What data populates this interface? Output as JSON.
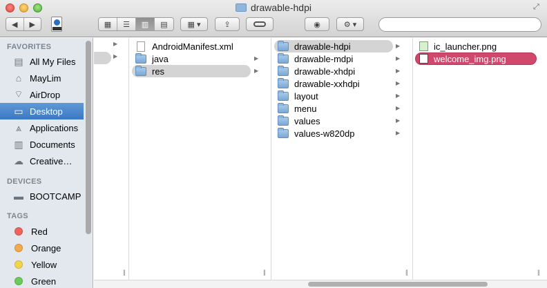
{
  "window": {
    "title": "drawable-hdpi"
  },
  "toolbar": {
    "back_icon": "chevron-left",
    "forward_icon": "chevron-right",
    "search_placeholder": "",
    "views": [
      "icon",
      "list",
      "column",
      "cover-flow"
    ],
    "active_view": "column"
  },
  "sidebar": {
    "favorites_header": "FAVORITES",
    "devices_header": "DEVICES",
    "tags_header": "TAGS",
    "favorites": [
      {
        "label": "All My Files",
        "icon": "all-files-icon"
      },
      {
        "label": "MayLim",
        "icon": "home-icon"
      },
      {
        "label": "AirDrop",
        "icon": "airdrop-icon"
      },
      {
        "label": "Desktop",
        "icon": "desktop-icon"
      },
      {
        "label": "Applications",
        "icon": "applications-icon"
      },
      {
        "label": "Documents",
        "icon": "documents-icon"
      },
      {
        "label": "Creative…",
        "icon": "creative-cloud-icon"
      }
    ],
    "devices": [
      {
        "label": "BOOTCAMP",
        "icon": "disk-icon"
      }
    ],
    "tags": [
      {
        "label": "Red",
        "color": "#f0625c"
      },
      {
        "label": "Orange",
        "color": "#f5a94a"
      },
      {
        "label": "Yellow",
        "color": "#f3d54b"
      },
      {
        "label": "Green",
        "color": "#6bcb5a"
      }
    ],
    "selected": "Desktop"
  },
  "columns": {
    "col2": [
      {
        "label": "AndroidManifest.xml",
        "kind": "file"
      },
      {
        "label": "java",
        "kind": "folder"
      },
      {
        "label": "res",
        "kind": "folder",
        "selected": true
      }
    ],
    "col3": [
      {
        "label": "drawable-hdpi",
        "kind": "folder",
        "selected": true
      },
      {
        "label": "drawable-mdpi",
        "kind": "folder"
      },
      {
        "label": "drawable-xhdpi",
        "kind": "folder"
      },
      {
        "label": "drawable-xxhdpi",
        "kind": "folder"
      },
      {
        "label": "layout",
        "kind": "folder"
      },
      {
        "label": "menu",
        "kind": "folder"
      },
      {
        "label": "values",
        "kind": "folder"
      },
      {
        "label": "values-w820dp",
        "kind": "folder"
      }
    ],
    "col4": [
      {
        "label": "ic_launcher.png",
        "kind": "image"
      },
      {
        "label": "welcome_img.png",
        "kind": "image",
        "selected": true
      }
    ]
  },
  "colors": {
    "selection_active": "#d0496d",
    "sidebar_selection": "#3a78c4"
  }
}
